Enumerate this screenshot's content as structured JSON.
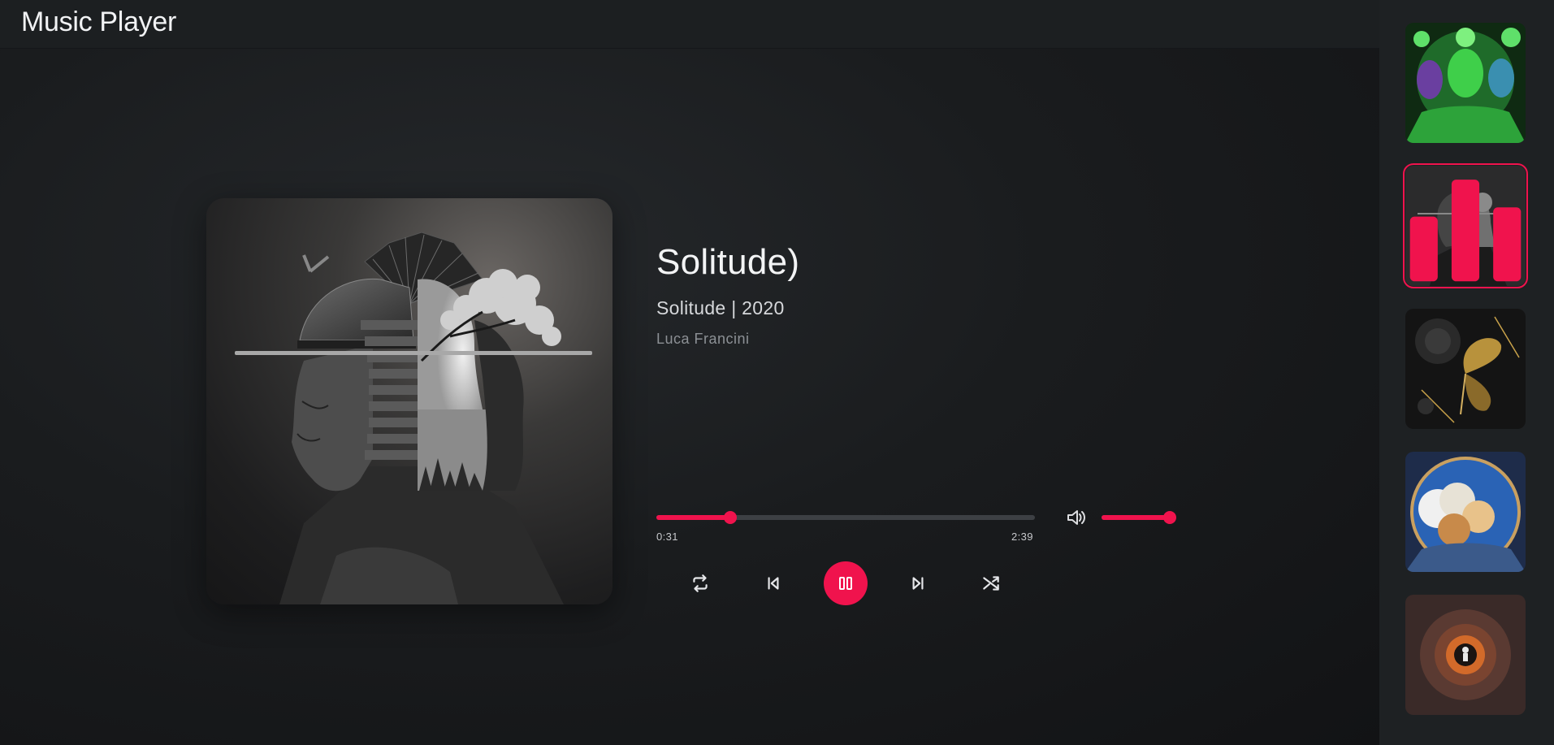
{
  "app": {
    "title": "Music Player"
  },
  "now_playing": {
    "title": "Solitude)",
    "album_line": "Solitude | 2020",
    "artist": "Luca Francini",
    "cover_icon": "samurai-geisha-artwork"
  },
  "progress": {
    "current_time": "0:31",
    "total_time": "2:39",
    "fraction": 0.195
  },
  "volume": {
    "level": 1.0,
    "icon": "volume-icon"
  },
  "controls": {
    "repeat_icon": "repeat-icon",
    "prev_icon": "skip-previous-icon",
    "pause_icon": "pause-icon",
    "next_icon": "skip-next-icon",
    "shuffle_icon": "shuffle-icon"
  },
  "playlist": [
    {
      "art": "green-faces-artwork",
      "active": false
    },
    {
      "art": "samurai-geisha-artwork",
      "active": true
    },
    {
      "art": "gold-butterfly-artwork",
      "active": false
    },
    {
      "art": "sky-portal-artwork",
      "active": false
    },
    {
      "art": "astronaut-tunnel-artwork",
      "active": false
    }
  ],
  "colors": {
    "accent": "#f0134d",
    "background": "#161819",
    "sidebar": "#1e2123"
  }
}
